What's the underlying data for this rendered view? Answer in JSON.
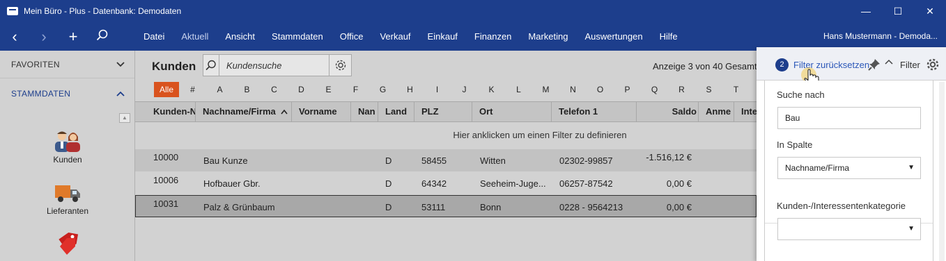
{
  "window": {
    "title": "Mein Büro - Plus - Datenbank: Demodaten",
    "controls": {
      "minimize": "—",
      "maximize": "☐",
      "close": "✕"
    }
  },
  "nav": {
    "back": "‹",
    "forward": "›",
    "add": "+"
  },
  "menu": {
    "items": [
      "Datei",
      "Aktuell",
      "Ansicht",
      "Stammdaten",
      "Office",
      "Verkauf",
      "Einkauf",
      "Finanzen",
      "Marketing",
      "Auswertungen",
      "Hilfe"
    ],
    "user": "Hans Mustermann - Demoda..."
  },
  "sidebar": {
    "favoriten": "FAVORITEN",
    "stammdaten": "STAMMDATEN",
    "items": [
      "Kunden",
      "Lieferanten"
    ]
  },
  "main": {
    "title": "Kunden",
    "search_placeholder": "Kundensuche",
    "count": "Anzeige 3 von 40 Gesamt",
    "alle": "Alle",
    "letters": [
      "#",
      "A",
      "B",
      "C",
      "D",
      "E",
      "F",
      "G",
      "H",
      "I",
      "J",
      "K",
      "L",
      "M",
      "N",
      "O",
      "P",
      "Q",
      "R",
      "S",
      "T"
    ],
    "columns": [
      "Kunden-N",
      "Nachname/Firma",
      "Vorname",
      "Nan",
      "Land",
      "PLZ",
      "Ort",
      "Telefon 1",
      "Saldo",
      "Anme",
      "Intere"
    ],
    "filter_hint": "Hier anklicken um einen Filter zu definieren",
    "rows": [
      [
        "10000",
        "Bau Kunze",
        "D",
        "58455",
        "Witten",
        "02302-99857",
        "-1.516,12 €"
      ],
      [
        "10006",
        "Hofbauer Gbr.",
        "D",
        "64342",
        "Seeheim-Juge...",
        "06257-87542",
        "0,00 €"
      ],
      [
        "10031",
        "Palz & Grünbaum",
        "D",
        "53111",
        "Bonn",
        "0228 - 9564213",
        "0,00 €"
      ]
    ]
  },
  "filter_panel": {
    "badge": "2",
    "reset": "Filter zurücksetzen",
    "title": "Filter",
    "suche_label": "Suche nach",
    "suche_value": "Bau",
    "spalte_label": "In Spalte",
    "spalte_value": "Nachname/Firma",
    "kategorie_label": "Kunden-/Interessentenkategorie",
    "kategorie_value": ""
  },
  "colors": {
    "titlebar": "#1d3e8c",
    "accent_orange": "#d9531e",
    "link_blue": "#2b57b8"
  }
}
